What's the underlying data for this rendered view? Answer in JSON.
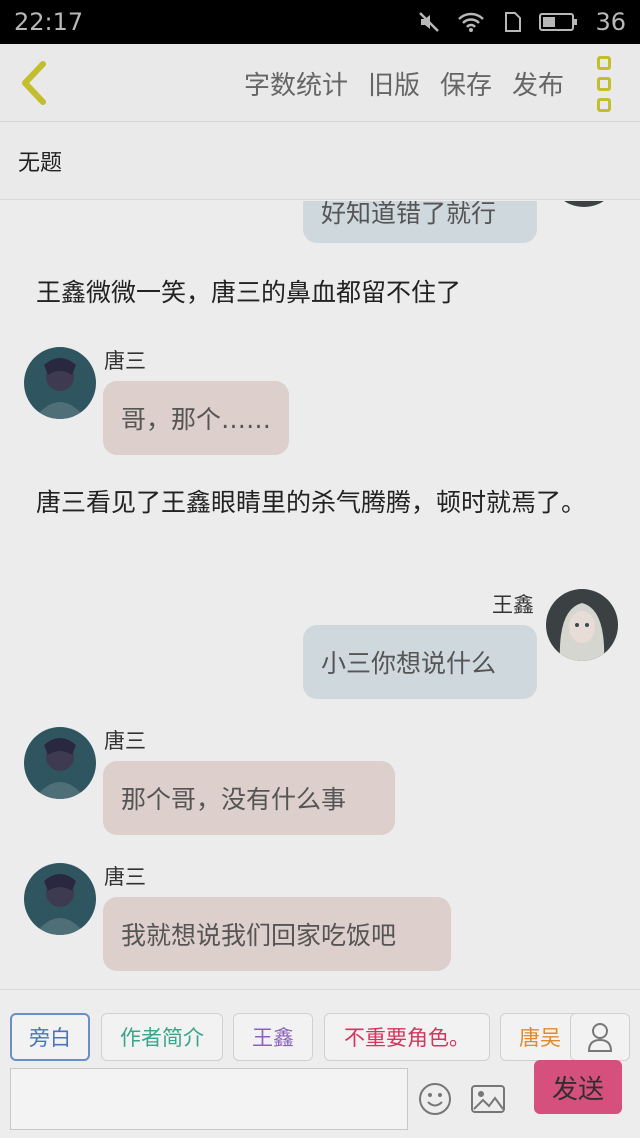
{
  "status_bar": {
    "time": "22:17",
    "battery": "36"
  },
  "toolbar": {
    "actions": [
      "字数统计",
      "旧版",
      "保存",
      "发布"
    ]
  },
  "document": {
    "title": "无题"
  },
  "messages": [
    {
      "type": "right",
      "text": "好知道错了就行"
    },
    {
      "type": "narration",
      "text": "王鑫微微一笑，唐三的鼻血都留不住了"
    },
    {
      "type": "left",
      "speaker": "唐三",
      "text": "哥，那个……"
    },
    {
      "type": "narration",
      "text": "唐三看见了王鑫眼睛里的杀气腾腾，顿时就焉了。"
    },
    {
      "type": "right",
      "speaker": "王鑫",
      "text": "小三你想说什么"
    },
    {
      "type": "left",
      "speaker": "唐三",
      "text": "那个哥，没有什么事"
    },
    {
      "type": "left",
      "speaker": "唐三",
      "text": "我就想说我们回家吃饭吧"
    }
  ],
  "roles": [
    {
      "label": "旁白",
      "color": "#4a73b8"
    },
    {
      "label": "作者简介",
      "color": "#3aa58a"
    },
    {
      "label": "王鑫",
      "color": "#8a63b8"
    },
    {
      "label": "不重要角色。",
      "color": "#d2355d"
    },
    {
      "label": "唐吴",
      "color": "#e08a2c"
    }
  ],
  "composer": {
    "send_label": "发送"
  },
  "colors": {
    "accent": "#c2be2e",
    "send": "#d5507c",
    "bubble_left": "#ddcfcb",
    "bubble_right": "#cfd8dc"
  }
}
